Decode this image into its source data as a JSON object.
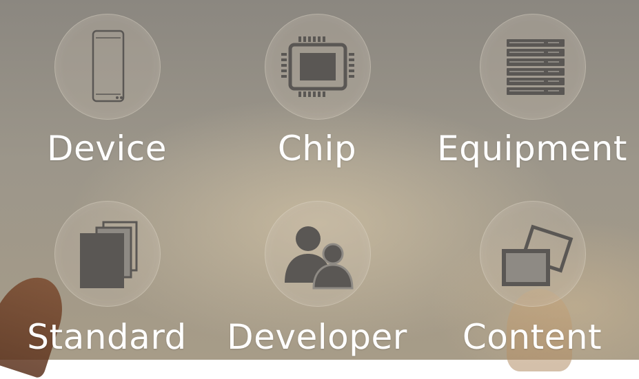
{
  "categories": [
    {
      "label": "Device",
      "icon": "smartphone-icon"
    },
    {
      "label": "Chip",
      "icon": "chip-icon"
    },
    {
      "label": "Equipment",
      "icon": "server-rack-icon"
    },
    {
      "label": "Standard",
      "icon": "documents-icon"
    },
    {
      "label": "Developer",
      "icon": "users-icon"
    },
    {
      "label": "Content",
      "icon": "photos-icon"
    }
  ],
  "colors": {
    "label": "#ffffff",
    "icon": "#5a5754"
  }
}
